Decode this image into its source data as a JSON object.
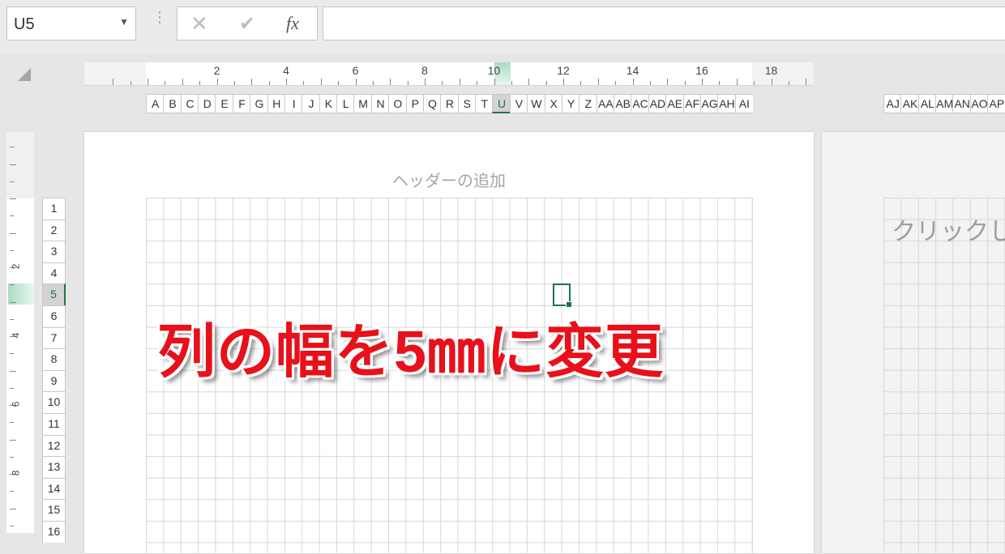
{
  "formula_bar": {
    "name_box": "U5",
    "dropdown_icon": "▼",
    "separator_icon": "⋮",
    "cancel_icon": "✕",
    "enter_icon": "✔",
    "fx_icon": "fx",
    "formula": ""
  },
  "ruler": {
    "labels": [
      "2",
      "4",
      "6",
      "8",
      "10",
      "12",
      "14",
      "16",
      "18"
    ],
    "vertical_labels": [
      "2",
      "4",
      "6",
      "8"
    ]
  },
  "columns": [
    "A",
    "B",
    "C",
    "D",
    "E",
    "F",
    "G",
    "H",
    "I",
    "J",
    "K",
    "L",
    "M",
    "N",
    "O",
    "P",
    "Q",
    "R",
    "S",
    "T",
    "U",
    "V",
    "W",
    "X",
    "Y",
    "Z",
    "AA",
    "AB",
    "AC",
    "AD",
    "AE",
    "AF",
    "AG",
    "AH",
    "AI"
  ],
  "active_column": "U",
  "columns_page2": [
    "AJ",
    "AK",
    "AL",
    "AM",
    "AN",
    "AO",
    "AP"
  ],
  "rows": [
    "1",
    "2",
    "3",
    "4",
    "5",
    "6",
    "7",
    "8",
    "9",
    "10",
    "11",
    "12",
    "13",
    "14",
    "15",
    "16"
  ],
  "active_row": "5",
  "page": {
    "header_hint": "ヘッダーの追加",
    "page2_hint": "クリックして"
  },
  "overlay": {
    "caption": "列の幅を5㎜に変更"
  },
  "colors": {
    "accent": "#217346",
    "caption": "#e8101a"
  }
}
